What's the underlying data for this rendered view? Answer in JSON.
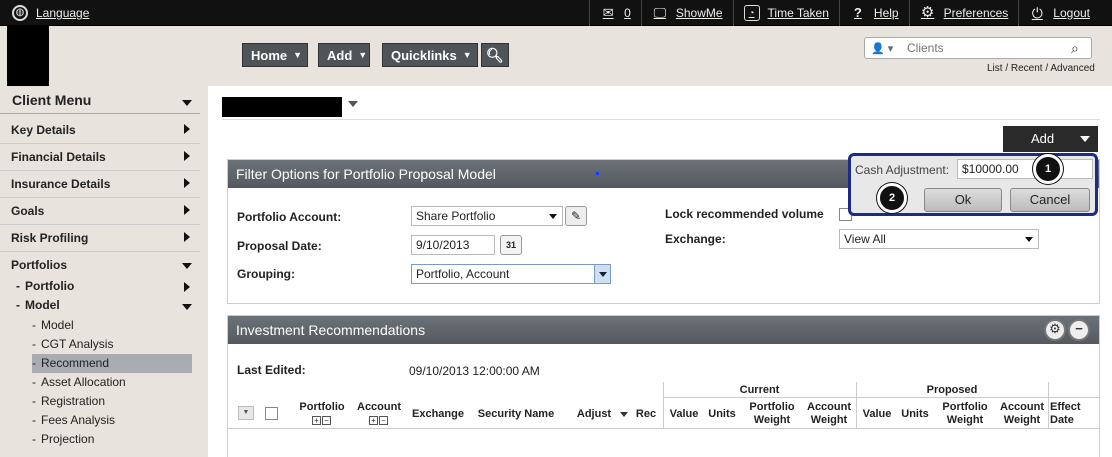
{
  "topbar": {
    "language": "Language",
    "messages_count": "0",
    "showme": "ShowMe",
    "time_taken": "Time Taken",
    "help_icon": "?",
    "help": "Help",
    "preferences": "Preferences",
    "logout": "Logout"
  },
  "header": {
    "nav": [
      {
        "label": "Home"
      },
      {
        "label": "Add"
      },
      {
        "label": "Quicklinks"
      }
    ],
    "search_placeholder": "Clients",
    "search_links": "List / Recent / Advanced"
  },
  "sidebar": {
    "title": "Client Menu",
    "items": [
      {
        "label": "Key Details"
      },
      {
        "label": "Financial Details"
      },
      {
        "label": "Insurance Details"
      },
      {
        "label": "Goals"
      },
      {
        "label": "Risk Profiling"
      },
      {
        "label": "Portfolios"
      }
    ],
    "portfolio_sub": "Portfolio",
    "model_sub": "Model",
    "model_items": [
      {
        "label": "Model"
      },
      {
        "label": "CGT Analysis"
      },
      {
        "label": "Recommend"
      },
      {
        "label": "Asset Allocation"
      },
      {
        "label": "Registration"
      },
      {
        "label": "Fees Analysis"
      },
      {
        "label": "Projection"
      }
    ]
  },
  "main": {
    "add_button": "Add",
    "filter": {
      "title": "Filter Options for Portfolio Proposal Model",
      "portfolio_account_label": "Portfolio Account:",
      "portfolio_account_value": "Share Portfolio",
      "proposal_date_label": "Proposal Date:",
      "proposal_date_value": "9/10/2013",
      "calendar_day": "31",
      "grouping_label": "Grouping:",
      "grouping_value": "Portfolio, Account",
      "lock_label": "Lock recommended volume",
      "exchange_label": "Exchange:",
      "exchange_value": "View All"
    },
    "popup": {
      "cash_label": "Cash Adjustment:",
      "cash_value": "$10000.00",
      "ok": "Ok",
      "cancel": "Cancel",
      "badge1": "1",
      "badge2": "2"
    },
    "recommend": {
      "title": "Investment Recommendations",
      "last_edited_label": "Last Edited:",
      "last_edited_value": "09/10/2013 12:00:00 AM",
      "group_current": "Current",
      "group_proposed": "Proposed",
      "col_portfolio": "Portfolio",
      "col_account": "Account",
      "col_exchange": "Exchange",
      "col_security": "Security Name",
      "col_adjust": "Adjust",
      "col_rec": "Rec",
      "col_value": "Value",
      "col_units": "Units",
      "col_portfolio_weight": "Portfolio Weight",
      "col_account_weight": "Account Weight",
      "col_effect_date": "Effect Date"
    }
  }
}
